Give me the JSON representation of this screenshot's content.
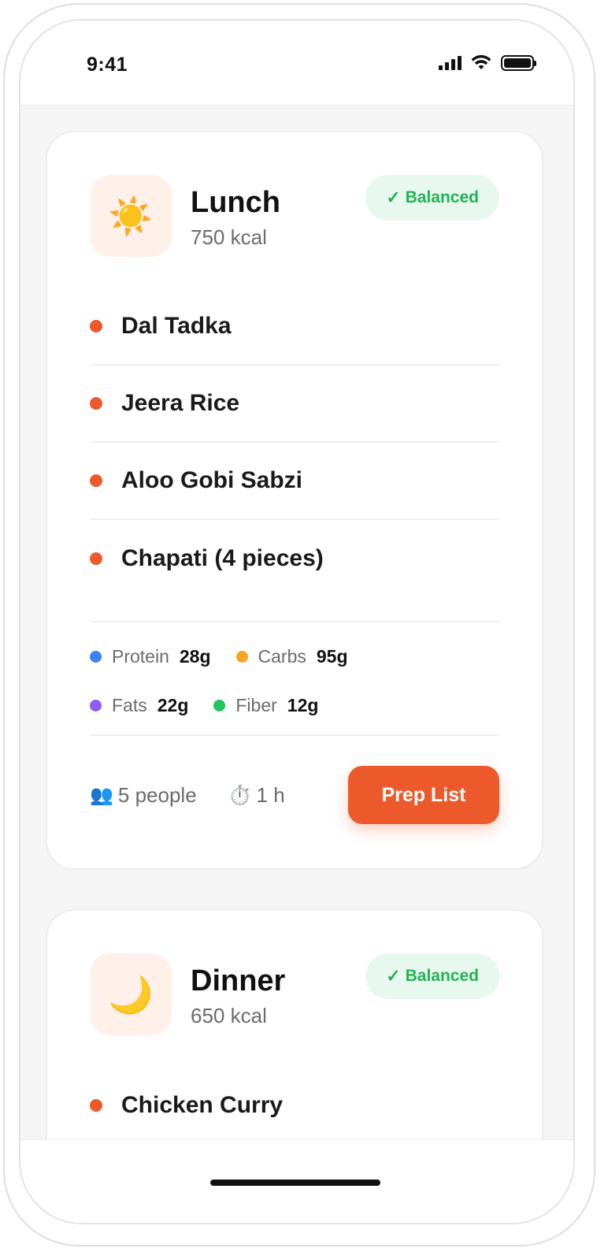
{
  "status_bar": {
    "time": "9:41"
  },
  "meals": [
    {
      "icon": "sun-icon",
      "icon_glyph": "☀️",
      "title": "Lunch",
      "kcal": "750 kcal",
      "badge": {
        "check": "✓",
        "label": "Balanced"
      },
      "dishes": [
        "Dal Tadka",
        "Jeera Rice",
        "Aloo Gobi Sabzi",
        "Chapati (4 pieces)"
      ],
      "macros": [
        {
          "label": "Protein",
          "value": "28g",
          "color": "#3b82f6"
        },
        {
          "label": "Carbs",
          "value": "95g",
          "color": "#f5a623"
        },
        {
          "label": "Fats",
          "value": "22g",
          "color": "#8b5cf6"
        },
        {
          "label": "Fiber",
          "value": "12g",
          "color": "#22c55e"
        }
      ],
      "servings": {
        "icon": "people-icon",
        "icon_glyph": "👥",
        "label": "5 people"
      },
      "duration": {
        "icon": "stopwatch-icon",
        "icon_glyph": "⏱️",
        "label": "1 h"
      },
      "action_label": "Prep List"
    },
    {
      "icon": "moon-icon",
      "icon_glyph": "🌙",
      "title": "Dinner",
      "kcal": "650 kcal",
      "badge": {
        "check": "✓",
        "label": "Balanced"
      },
      "dishes": [
        "Chicken Curry"
      ]
    }
  ],
  "colors": {
    "accent": "#ec5a2b",
    "badge_text": "#22b356",
    "badge_bg": "#e9f8ee",
    "icon_bg": "#fff1ea"
  }
}
